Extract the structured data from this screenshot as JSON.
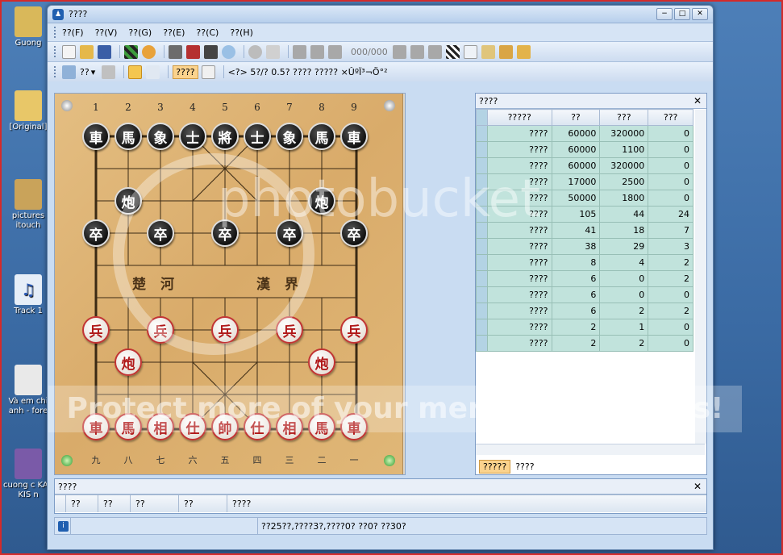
{
  "desktop": {
    "icons": [
      {
        "label": "Guong",
        "color": "#d9b85a"
      },
      {
        "label": "[Original]",
        "color": "#e8c768"
      },
      {
        "label": "pictures itouch",
        "color": "#c9a35a"
      },
      {
        "label": "Track 1",
        "color": "#e6eef8"
      },
      {
        "label": "Và em chỉ anh - fore",
        "color": "#e9e9e9"
      },
      {
        "label": "cuong c KAV KIS n",
        "color": "#7a5aa8"
      }
    ]
  },
  "window": {
    "title": "????",
    "buttons": {
      "minimize": "−",
      "maximize": "□",
      "close": "✕"
    }
  },
  "menu": [
    "??(F)",
    "??(V)",
    "??(G)",
    "??(E)",
    "??(C)",
    "??(H)"
  ],
  "toolbar": {
    "move_counter": "000/000",
    "row2_label": "??",
    "row2_active": "????",
    "row2_status": "<?> 5?/? 0.5?   ????  ?????  ×ÛºÏ³¬Ö°²"
  },
  "board": {
    "column_numbers": [
      "1",
      "2",
      "3",
      "4",
      "5",
      "6",
      "7",
      "8",
      "9"
    ],
    "column_chinese": [
      "九",
      "八",
      "七",
      "六",
      "五",
      "四",
      "三",
      "二",
      "一"
    ],
    "river_left": "楚河",
    "river_right": "漢界",
    "black_pieces": {
      "back_row": [
        "車",
        "馬",
        "象",
        "士",
        "將",
        "士",
        "象",
        "馬",
        "車"
      ],
      "cannon": "炮",
      "soldier": "卒"
    },
    "red_pieces": {
      "back_row": [
        "車",
        "馬",
        "相",
        "仕",
        "帥",
        "仕",
        "相",
        "馬",
        "車"
      ],
      "cannon": "炮",
      "soldier": "兵"
    }
  },
  "panel": {
    "title": "????",
    "columns": [
      "?????",
      "??",
      "???",
      "???"
    ],
    "rows": [
      [
        "????",
        "60000",
        "320000",
        "0"
      ],
      [
        "????",
        "60000",
        "1100",
        "0"
      ],
      [
        "????",
        "60000",
        "320000",
        "0"
      ],
      [
        "????",
        "17000",
        "2500",
        "0"
      ],
      [
        "????",
        "50000",
        "1800",
        "0"
      ],
      [
        "????",
        "105",
        "44",
        "24"
      ],
      [
        "????",
        "41",
        "18",
        "7"
      ],
      [
        "????",
        "38",
        "29",
        "3"
      ],
      [
        "????",
        "8",
        "4",
        "2"
      ],
      [
        "????",
        "6",
        "0",
        "2"
      ],
      [
        "????",
        "6",
        "0",
        "0"
      ],
      [
        "????",
        "6",
        "2",
        "2"
      ],
      [
        "????",
        "2",
        "1",
        "0"
      ],
      [
        "????",
        "2",
        "2",
        "0"
      ]
    ],
    "tabs": [
      "?????",
      "????"
    ]
  },
  "bottom": {
    "title": "????",
    "columns": [
      "??",
      "??",
      "??",
      "??",
      "????"
    ]
  },
  "status": {
    "text": "??25??,????3?,????0? ??0? ??30?"
  },
  "watermark": {
    "top": "photobucket",
    "bottom": "Protect more of your memories for less!"
  }
}
